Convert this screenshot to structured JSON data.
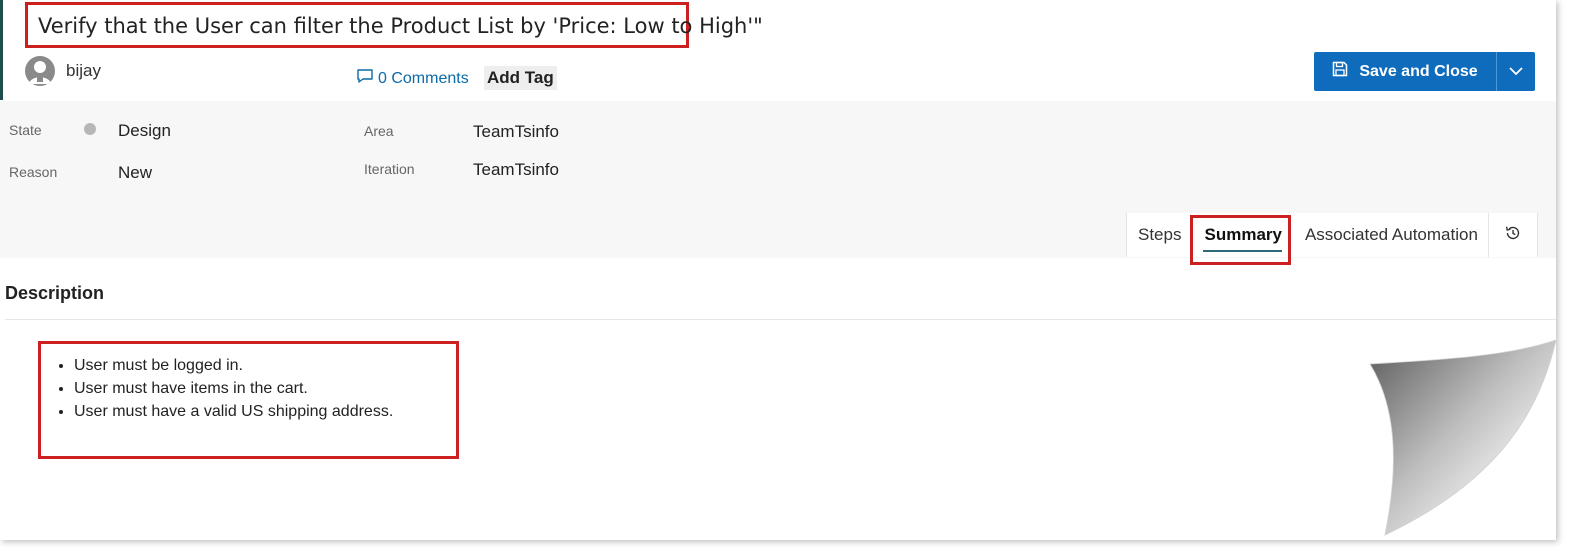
{
  "work_item": {
    "title": "Verify that the User can filter the Product List by 'Price: Low to High'\"",
    "author": "bijay",
    "comments_label": "0 Comments",
    "add_tag_label": "Add Tag",
    "save_label": "Save and Close"
  },
  "fields": {
    "state_label": "State",
    "state_value": "Design",
    "reason_label": "Reason",
    "reason_value": "New",
    "area_label": "Area",
    "area_value": "TeamTsinfo",
    "iteration_label": "Iteration",
    "iteration_value": "TeamTsinfo"
  },
  "tabs": [
    {
      "label": "Steps"
    },
    {
      "label": "Summary",
      "selected": true
    },
    {
      "label": "Associated Automation"
    }
  ],
  "description": {
    "heading": "Description",
    "items": [
      "User must be logged in.",
      "User must have items in the cart.",
      "User must have a valid US shipping address."
    ]
  },
  "icons": {
    "avatar": "person-avatar-icon",
    "comments": "comment-bubble-icon",
    "save": "floppy-disk-icon",
    "dropdown": "chevron-down-icon",
    "history": "history-icon",
    "state_indicator": "status-dot"
  },
  "colors": {
    "primary_button": "#0f6cbd",
    "highlight_border": "#cc1f1f",
    "link": "#0b6aa8",
    "state_dot": "#b7b7b7"
  }
}
